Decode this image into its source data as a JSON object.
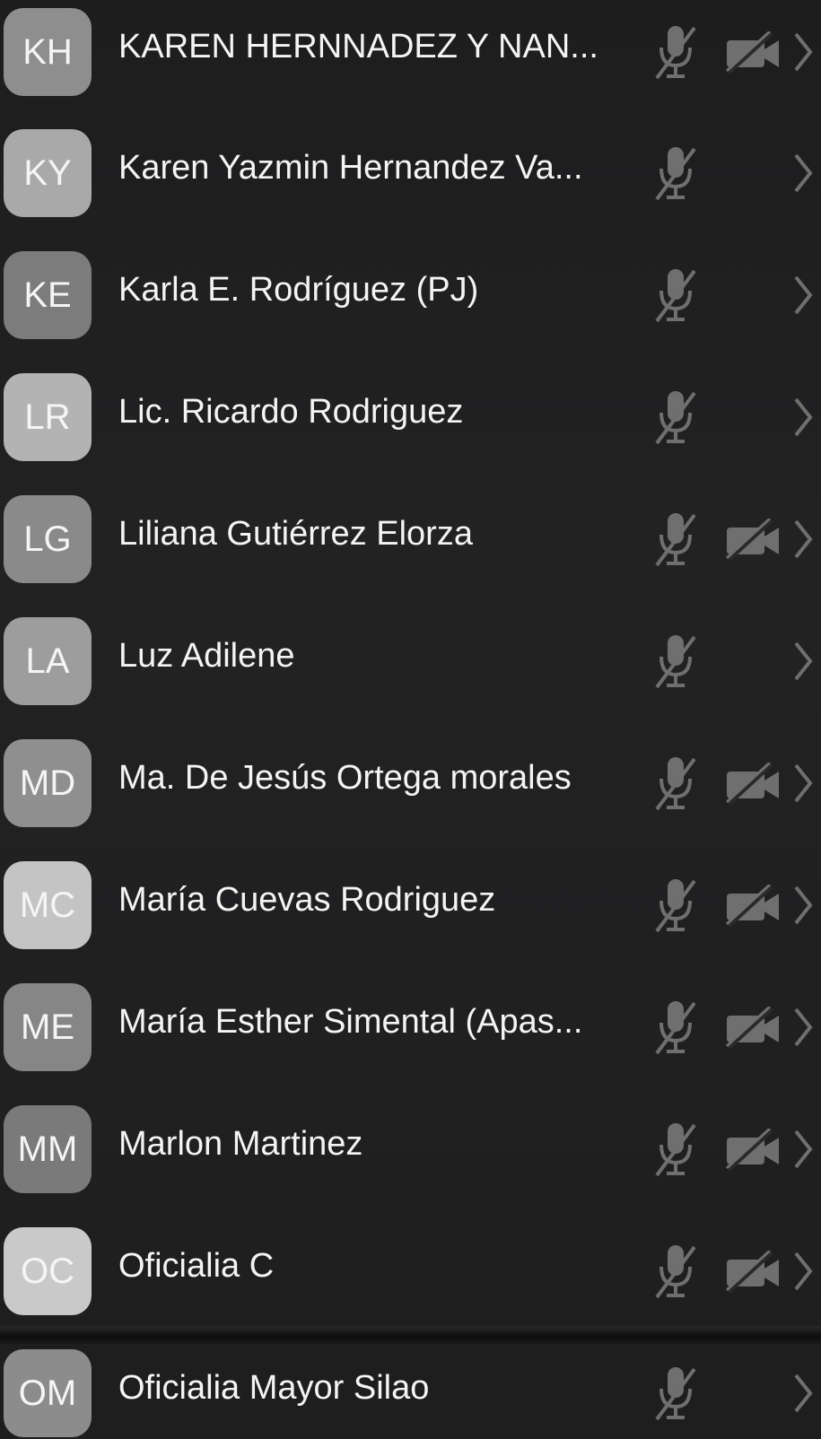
{
  "participants": [
    {
      "initials": "KH",
      "name": "KAREN HERNNADEZ Y NAN...",
      "avatar_color": "#8e8e8e",
      "mic_muted": true,
      "camera_off": true
    },
    {
      "initials": "KY",
      "name": "Karen Yazmin Hernandez Va...",
      "avatar_color": "#a9a9a9",
      "mic_muted": true,
      "camera_off": false
    },
    {
      "initials": "KE",
      "name": "Karla E. Rodríguez (PJ)",
      "avatar_color": "#7c7c7c",
      "mic_muted": true,
      "camera_off": false
    },
    {
      "initials": "LR",
      "name": "Lic. Ricardo Rodriguez",
      "avatar_color": "#b3b3b3",
      "mic_muted": true,
      "camera_off": false
    },
    {
      "initials": "LG",
      "name": "Liliana Gutiérrez Elorza",
      "avatar_color": "#8a8a8a",
      "mic_muted": true,
      "camera_off": true
    },
    {
      "initials": "LA",
      "name": "Luz Adilene",
      "avatar_color": "#9d9d9d",
      "mic_muted": true,
      "camera_off": false
    },
    {
      "initials": "MD",
      "name": "Ma. De Jesús Ortega morales",
      "avatar_color": "#8f8f8f",
      "mic_muted": true,
      "camera_off": true
    },
    {
      "initials": "MC",
      "name": "María Cuevas Rodriguez",
      "avatar_color": "#c4c4c4",
      "mic_muted": true,
      "camera_off": true
    },
    {
      "initials": "ME",
      "name": "María Esther Simental (Apas...",
      "avatar_color": "#868686",
      "mic_muted": true,
      "camera_off": true
    },
    {
      "initials": "MM",
      "name": "Marlon Martinez",
      "avatar_color": "#7a7a7a",
      "mic_muted": true,
      "camera_off": true
    },
    {
      "initials": "OC",
      "name": "Oficialia C",
      "avatar_color": "#c9c9c9",
      "mic_muted": true,
      "camera_off": true
    },
    {
      "initials": "OM",
      "name": "Oficialia Mayor Silao",
      "avatar_color": "#8c8c8c",
      "mic_muted": true,
      "camera_off": false
    }
  ],
  "icons": {
    "mic": "mic-muted-icon",
    "camera": "camera-off-icon",
    "chevron": "chevron-right-icon"
  },
  "colors": {
    "background": "#202021",
    "icon_gray": "#6f6f6f",
    "text": "#f2f2f2"
  }
}
